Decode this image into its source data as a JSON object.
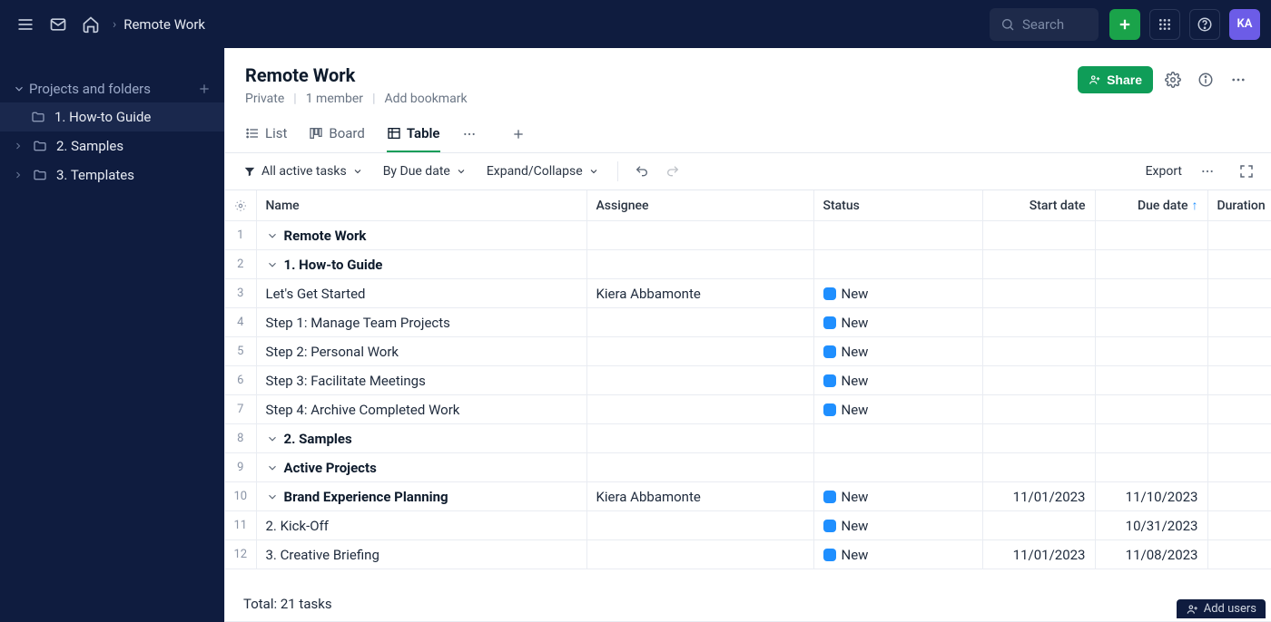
{
  "topbar": {
    "breadcrumb": "Remote Work",
    "search_placeholder": "Search",
    "avatar_initials": "KA"
  },
  "sidebar": {
    "section_label": "Projects and folders",
    "items": [
      {
        "label": "1. How-to Guide",
        "active": true,
        "has_chev": false
      },
      {
        "label": "2. Samples",
        "active": false,
        "has_chev": true
      },
      {
        "label": "3. Templates",
        "active": false,
        "has_chev": true
      }
    ]
  },
  "header": {
    "title": "Remote Work",
    "privacy": "Private",
    "members": "1 member",
    "bookmark": "Add bookmark",
    "share_label": "Share"
  },
  "tabs": {
    "list": "List",
    "board": "Board",
    "table": "Table"
  },
  "toolbar": {
    "filter": "All active tasks",
    "sort": "By Due date",
    "expand": "Expand/Collapse",
    "export": "Export"
  },
  "columns": {
    "name": "Name",
    "assignee": "Assignee",
    "status": "Status",
    "start": "Start date",
    "due": "Due date",
    "duration": "Duration"
  },
  "rows": [
    {
      "num": 1,
      "indent": 0,
      "chev": true,
      "bold": true,
      "name": "Remote Work"
    },
    {
      "num": 2,
      "indent": 1,
      "chev": true,
      "bold": true,
      "name": "1. How-to Guide"
    },
    {
      "num": 3,
      "indent": 2,
      "name": "Let's Get Started",
      "assignee": "Kiera Abbamonte",
      "status": "New"
    },
    {
      "num": 4,
      "indent": 2,
      "name": "Step 1: Manage Team Projects",
      "status": "New"
    },
    {
      "num": 5,
      "indent": 2,
      "name": "Step 2: Personal Work",
      "status": "New"
    },
    {
      "num": 6,
      "indent": 2,
      "name": "Step 3: Facilitate Meetings",
      "status": "New"
    },
    {
      "num": 7,
      "indent": 2,
      "name": "Step 4: Archive Completed Work",
      "status": "New"
    },
    {
      "num": 8,
      "indent": 1,
      "chev": true,
      "bold": true,
      "name": "2. Samples"
    },
    {
      "num": 9,
      "indent": 2,
      "chev": true,
      "bold": true,
      "name": "Active Projects"
    },
    {
      "num": 10,
      "indent": 3,
      "chev": true,
      "bold": true,
      "name": "Brand Experience Planning",
      "assignee": "Kiera Abbamonte",
      "status": "New",
      "start": "11/01/2023",
      "due": "11/10/2023"
    },
    {
      "num": 11,
      "indent": 4,
      "name": "2. Kick-Off",
      "status": "New",
      "due": "10/31/2023"
    },
    {
      "num": 12,
      "indent": 4,
      "name": "3. Creative Briefing",
      "status": "New",
      "start": "11/01/2023",
      "due": "11/08/2023"
    }
  ],
  "total": "Total: 21 tasks",
  "footer": {
    "add_users": "Add users"
  }
}
